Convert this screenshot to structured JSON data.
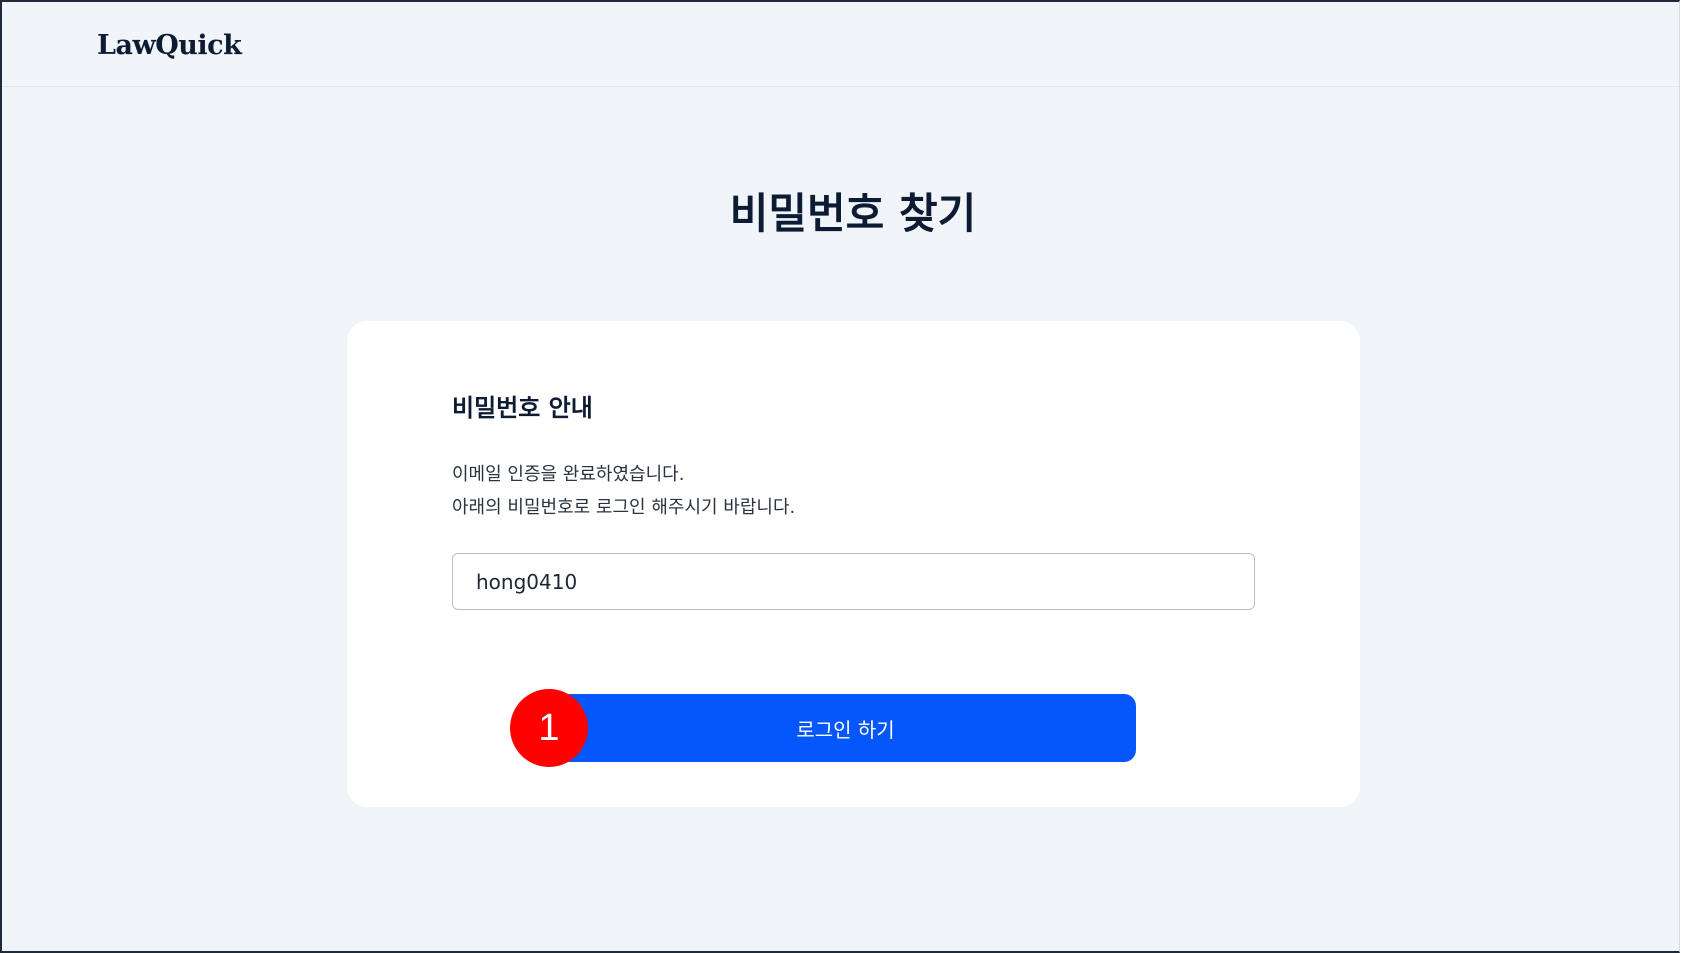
{
  "header": {
    "logo_text": "LawQuick"
  },
  "page": {
    "title": "비밀번호 찾기"
  },
  "card": {
    "title": "비밀번호 안내",
    "message_lines": [
      "이메일 인증을 완료하였습니다.",
      "아래의 비밀번호로 로그인 해주시기 바랍니다."
    ],
    "password_value": "hong0410",
    "login_button_label": "로그인 하기"
  },
  "annotation": {
    "step_number": "1"
  },
  "colors": {
    "accent": "#0557fb",
    "background": "#f1f5fa",
    "step_badge": "#ff0000"
  }
}
